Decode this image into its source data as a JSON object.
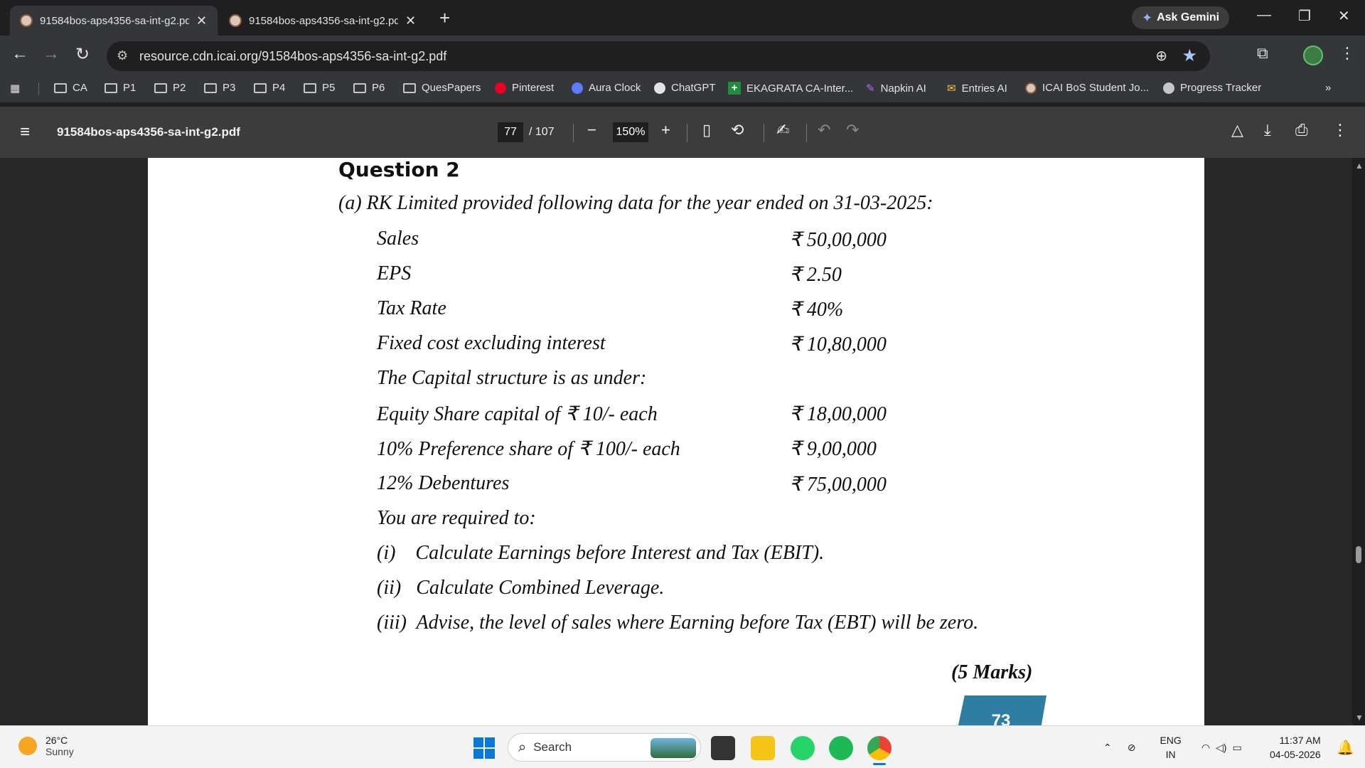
{
  "browser": {
    "tabs": [
      {
        "title": "91584bos-aps4356-sa-int-g2.pdf",
        "active": true
      },
      {
        "title": "91584bos-aps4356-sa-int-g2.pdf",
        "active": false
      }
    ],
    "gemini_label": "Ask Gemini",
    "url": "resource.cdn.icai.org/91584bos-aps4356-sa-int-g2.pdf"
  },
  "bookmarks": [
    {
      "label": "CA",
      "icon": "folder-icon"
    },
    {
      "label": "P1",
      "icon": "folder-icon"
    },
    {
      "label": "P2",
      "icon": "folder-icon"
    },
    {
      "label": "P3",
      "icon": "folder-icon"
    },
    {
      "label": "P4",
      "icon": "folder-icon"
    },
    {
      "label": "P5",
      "icon": "folder-icon"
    },
    {
      "label": "P6",
      "icon": "folder-icon"
    },
    {
      "label": "QuesPapers",
      "icon": "folder-icon"
    },
    {
      "label": "Pinterest",
      "icon": "pinterest-icon"
    },
    {
      "label": "Aura Clock",
      "icon": "clock-icon"
    },
    {
      "label": "ChatGPT",
      "icon": "chatgpt-icon"
    },
    {
      "label": "EKAGRATA CA-Inter...",
      "icon": "plus-icon"
    },
    {
      "label": "Napkin AI",
      "icon": "napkin-icon"
    },
    {
      "label": "Entries AI",
      "icon": "entries-icon"
    },
    {
      "label": "ICAI BoS Student Jo...",
      "icon": "icai-icon"
    },
    {
      "label": "Progress Tracker",
      "icon": "tracker-icon"
    }
  ],
  "pdf_toolbar": {
    "filename": "91584bos-aps4356-sa-int-g2.pdf",
    "page_current": "77",
    "page_total": "/ 107",
    "zoom": "150%"
  },
  "document": {
    "question_heading": "Question 2",
    "intro": "(a)  RK Limited provided following data for the year ended on 31-03-2025:",
    "data_rows": [
      {
        "label": "Sales",
        "value": "₹ 50,00,000"
      },
      {
        "label": "EPS",
        "value": "₹ 2.50"
      },
      {
        "label": "Tax Rate",
        "value": "₹ 40%"
      },
      {
        "label": "Fixed cost excluding interest",
        "value": "₹ 10,80,000"
      }
    ],
    "capital_heading": "The Capital structure is as under:",
    "capital_rows": [
      {
        "label": "Equity Share capital of ₹ 10/- each",
        "value": "₹ 18,00,000"
      },
      {
        "label": "10% Preference share of ₹ 100/- each",
        "value": "₹ 9,00,000"
      },
      {
        "label": "12% Debentures",
        "value": "₹ 75,00,000"
      }
    ],
    "required_heading": "You are required to:",
    "requirements": [
      "(i)    Calculate Earnings before Interest and Tax (EBIT).",
      "(ii)   Calculate Combined Leverage.",
      "(iii)  Advise, the level of sales where Earning before Tax (EBT) will be zero."
    ],
    "marks": "(5 Marks)",
    "page_number": "73"
  },
  "taskbar": {
    "temperature": "26°C",
    "weather": "Sunny",
    "search_placeholder": "Search",
    "lang_top": "ENG",
    "lang_bottom": "IN",
    "time": "11:37 AM",
    "date": "04-05-2026"
  },
  "colors": {
    "tab_active": "#35363a",
    "pdf_toolbar": "#3c3c3c",
    "page_badge": "#2e7ea3",
    "windows_blue": "#0a78d7"
  }
}
